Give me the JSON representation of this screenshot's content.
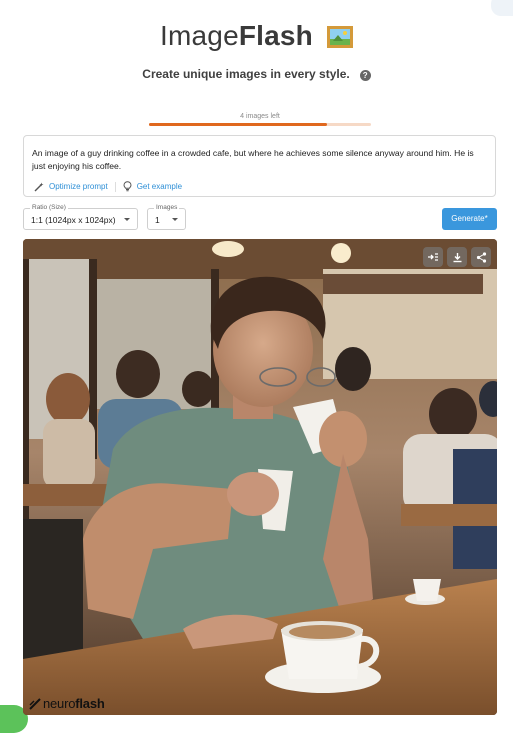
{
  "brand": {
    "title_light": "Image",
    "title_bold": "Flash",
    "icon": "framed-picture-icon"
  },
  "tagline": "Create unique images in every style.",
  "credits": {
    "label": "4 images left",
    "fraction_used": 0.8
  },
  "prompt": {
    "text": "An image of a guy drinking coffee in a crowded cafe, but where he achieves some silence anyway around him. He is just enjoying his coffee.",
    "optimize_label": "Optimize prompt",
    "example_label": "Get example"
  },
  "ratio": {
    "label": "Ratio (Size)",
    "value": "1:1 (1024px x 1024px)"
  },
  "images": {
    "label": "Images",
    "value": "1"
  },
  "generate_label": "Generate*",
  "image_tools": [
    "insert-prompt-icon",
    "download-icon",
    "share-icon"
  ],
  "watermark": {
    "light": "neuro",
    "bold": "flash"
  },
  "colors": {
    "accent": "#3a97dd",
    "progress": "#e0681e",
    "progress_track": "#f6d9c6"
  }
}
